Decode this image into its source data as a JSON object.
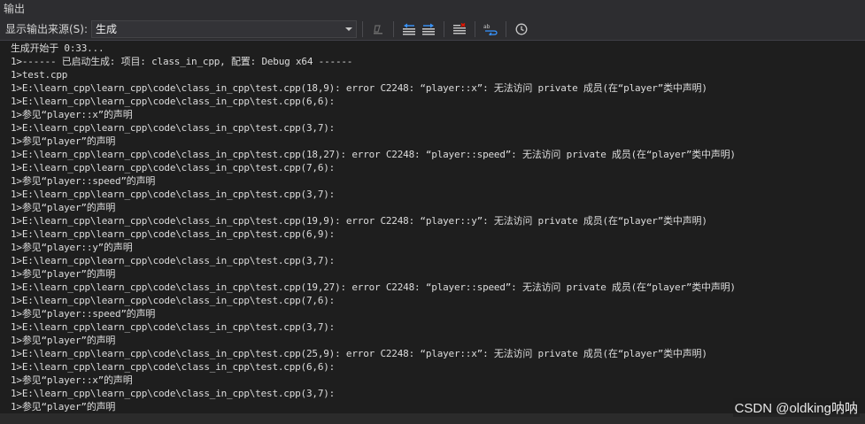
{
  "panel": {
    "title": "输出"
  },
  "toolbar": {
    "source_label": "显示输出来源(S):",
    "source_value": "生成",
    "icons": [
      "clear-output-icon",
      "prev-message-icon",
      "next-message-icon",
      "clear-all-icon",
      "word-wrap-icon",
      "clock-icon"
    ]
  },
  "output": {
    "lines": [
      "生成开始于 0:33...",
      "1>------ 已启动生成: 项目: class_in_cpp, 配置: Debug x64 ------",
      "1>test.cpp",
      "1>E:\\learn_cpp\\learn_cpp\\code\\class_in_cpp\\test.cpp(18,9): error C2248: “player::x”: 无法访问 private 成员(在“player”类中声明)",
      "1>E:\\learn_cpp\\learn_cpp\\code\\class_in_cpp\\test.cpp(6,6):",
      "1>参见“player::x”的声明",
      "1>E:\\learn_cpp\\learn_cpp\\code\\class_in_cpp\\test.cpp(3,7):",
      "1>参见“player”的声明",
      "1>E:\\learn_cpp\\learn_cpp\\code\\class_in_cpp\\test.cpp(18,27): error C2248: “player::speed”: 无法访问 private 成员(在“player”类中声明)",
      "1>E:\\learn_cpp\\learn_cpp\\code\\class_in_cpp\\test.cpp(7,6):",
      "1>参见“player::speed”的声明",
      "1>E:\\learn_cpp\\learn_cpp\\code\\class_in_cpp\\test.cpp(3,7):",
      "1>参见“player”的声明",
      "1>E:\\learn_cpp\\learn_cpp\\code\\class_in_cpp\\test.cpp(19,9): error C2248: “player::y”: 无法访问 private 成员(在“player”类中声明)",
      "1>E:\\learn_cpp\\learn_cpp\\code\\class_in_cpp\\test.cpp(6,9):",
      "1>参见“player::y”的声明",
      "1>E:\\learn_cpp\\learn_cpp\\code\\class_in_cpp\\test.cpp(3,7):",
      "1>参见“player”的声明",
      "1>E:\\learn_cpp\\learn_cpp\\code\\class_in_cpp\\test.cpp(19,27): error C2248: “player::speed”: 无法访问 private 成员(在“player”类中声明)",
      "1>E:\\learn_cpp\\learn_cpp\\code\\class_in_cpp\\test.cpp(7,6):",
      "1>参见“player::speed”的声明",
      "1>E:\\learn_cpp\\learn_cpp\\code\\class_in_cpp\\test.cpp(3,7):",
      "1>参见“player”的声明",
      "1>E:\\learn_cpp\\learn_cpp\\code\\class_in_cpp\\test.cpp(25,9): error C2248: “player::x”: 无法访问 private 成员(在“player”类中声明)",
      "1>E:\\learn_cpp\\learn_cpp\\code\\class_in_cpp\\test.cpp(6,6):",
      "1>参见“player::x”的声明",
      "1>E:\\learn_cpp\\learn_cpp\\code\\class_in_cpp\\test.cpp(3,7):",
      "1>参见“player”的声明"
    ]
  },
  "watermark": "CSDN @oldking呐呐",
  "colors": {
    "background": "#1e1e1e",
    "toolbar": "#2d2d30",
    "text": "#dcdcdc"
  }
}
